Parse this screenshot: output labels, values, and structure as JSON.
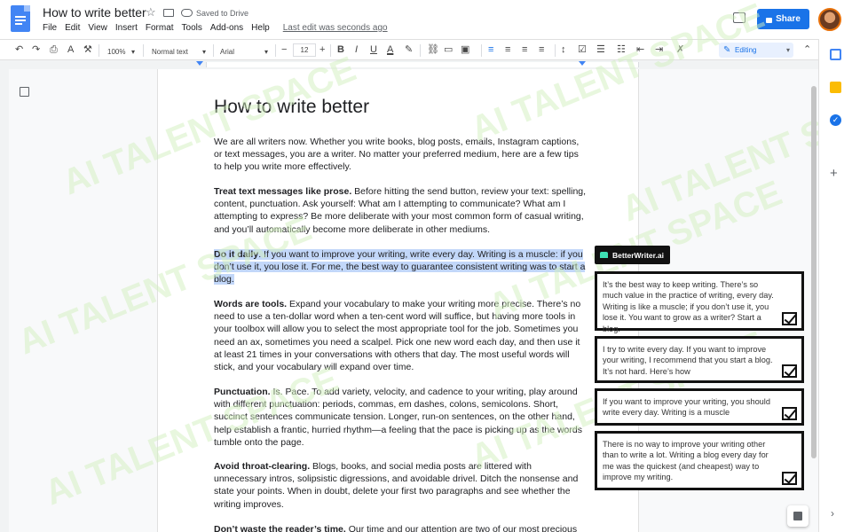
{
  "header": {
    "doc_title": "How to write better",
    "saved_status": "Saved to Drive",
    "menu": [
      "File",
      "Edit",
      "View",
      "Insert",
      "Format",
      "Tools",
      "Add-ons",
      "Help"
    ],
    "last_edit": "Last edit was seconds ago",
    "share_label": "Share"
  },
  "toolbar": {
    "zoom": "100%",
    "style": "Normal text",
    "font": "Arial",
    "font_size": "12",
    "mode": "Editing"
  },
  "document": {
    "title": "How to write better",
    "paragraphs": [
      {
        "bold": "",
        "text": "We are all writers now. Whether you write books, blog posts, emails, Instagram captions, or text messages, you are a writer. No matter your preferred medium, here are a few tips to help you write more effectively."
      },
      {
        "bold": "Treat text messages like prose.",
        "text": " Before hitting the send button, review your text: spelling, content, punctuation. Ask yourself: What am I attempting to communicate? What am I attempting to express? Be more deliberate with your most common form of casual writing, and you’ll automatically become more deliberate in other mediums."
      },
      {
        "bold": "Do it daily",
        "text": ". If you want to improve your writing, write every day. Writing is a muscle: if you don’t use it, you lose it. For me, the best way to guarantee consistent writing was to start a blog."
      },
      {
        "bold": "Words are tools.",
        "text": " Expand your vocabulary to make your writing more precise. There’s no need to use a ten-dollar word when a ten-cent word will suffice, but having more tools in your toolbox will allow you to select the most appropriate tool for the job. Sometimes you need an ax, sometimes you need a scalpel. Pick one new word each day, and then use it at least 21 times in your conversations with others that day. The most useful words will stick, and your vocabulary will expand over time."
      },
      {
        "bold": "Punctuation.",
        "text": " Is. Pace. To add variety, velocity, and cadence to your writing, play around with different punctuation: periods, commas, em dashes, colons, semicolons. Short, succinct sentences communicate tension. Longer, run-on sentences, on the other hand, help establish a frantic, hurried rhythm—a feeling that the pace is picking up as the words tumble onto the page."
      },
      {
        "bold": "Avoid throat-clearing.",
        "text": " Blogs, books, and social media posts are littered with unnecessary intros, solipsistic digressions, and avoidable drivel. Ditch the nonsense and state your points. When in doubt, delete your first two paragraphs and see whether the writing improves."
      },
      {
        "bold": "Don’t waste the reader’s time.",
        "text": " Our time and our attention are two of our most precious"
      }
    ]
  },
  "watermark": "AI TALENT SPACE",
  "better_writer": {
    "title": "BetterWriter.ai",
    "suggestions": [
      "It’s the best way to keep writing. There’s so much value in the practice of writing, every day. Writing is like a muscle; if you don’t use it, you lose it. You want to grow as a writer? Start a blog.",
      "I try to write every day. If you want to improve your writing, I recommend that you start a blog. It’s not hard. Here’s how",
      "If you want to improve your writing, you should write every day. Writing is a muscle",
      "There is no way to improve your writing other than to write a lot. Writing a blog every day for me was the quickest (and cheapest) way to improve my writing."
    ]
  },
  "colors": {
    "accent": "#1a73e8",
    "highlight": "#c2d7f9",
    "bw_header": "#111111",
    "bw_logo": "#3ee0b4"
  }
}
